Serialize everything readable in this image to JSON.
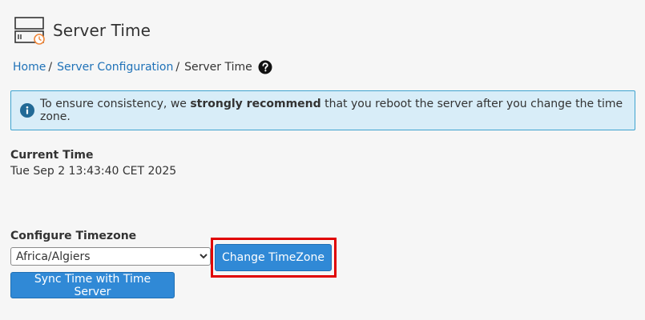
{
  "header": {
    "title": "Server Time",
    "icon": "server-clock-icon"
  },
  "breadcrumb": {
    "home": "Home",
    "separator": "/",
    "section": "Server Configuration",
    "current": "Server Time",
    "help_icon": "question-circle-icon"
  },
  "alert": {
    "icon": "info-icon",
    "text_before": "To ensure consistency, we ",
    "text_bold": "strongly recommend",
    "text_after": " that you reboot the server after you change the time zone."
  },
  "current_time": {
    "label": "Current Time",
    "value": "Tue Sep 2 13:43:40 CET 2025"
  },
  "timezone": {
    "label": "Configure Timezone",
    "selected": "Africa/Algiers",
    "change_button": "Change TimeZone",
    "sync_button": "Sync Time with Time Server"
  },
  "colors": {
    "link": "#1f72b8",
    "primary_button": "#3089d6",
    "alert_bg": "#d8edf8",
    "alert_border": "#3ea3cf",
    "highlight": "#e00000",
    "accent_clock": "#f0873a"
  }
}
